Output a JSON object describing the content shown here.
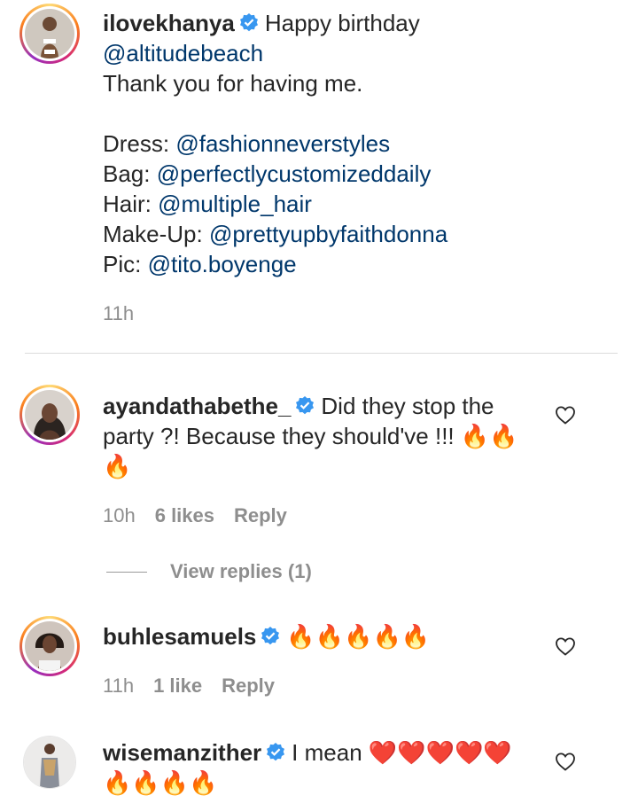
{
  "post": {
    "username": "ilovekhanya",
    "caption_first": "Happy birthday",
    "caption_mention": "@altitudebeach",
    "caption_line2": "Thank you for having me.",
    "credits": [
      {
        "label": "Dress:",
        "mention": "@fashionneverstyles"
      },
      {
        "label": "Bag:",
        "mention": "@perfectlycustomizeddaily"
      },
      {
        "label": "Hair:",
        "mention": "@multiple_hair"
      },
      {
        "label": "Make-Up:",
        "mention": "@prettyupbyfaithdonna"
      },
      {
        "label": "Pic:",
        "mention": "@tito.boyenge"
      }
    ],
    "time": "11h"
  },
  "comments": [
    {
      "username": "ayandathabethe_",
      "text": "Did they stop the party ?! Because they should've !!! 🔥🔥",
      "text_line2": "🔥",
      "time": "10h",
      "likes": "6 likes",
      "reply": "Reply",
      "view_replies": "View replies (1)"
    },
    {
      "username": "buhlesamuels",
      "text": "🔥🔥🔥🔥🔥",
      "time": "11h",
      "likes": "1 like",
      "reply": "Reply"
    },
    {
      "username": "wisemanzither",
      "text": "I mean ❤️❤️❤️❤️❤️",
      "text_line2": "🔥🔥🔥🔥"
    }
  ],
  "colors": {
    "mention": "#00376b",
    "verified": "#3897f0",
    "muted": "#8e8e8e"
  },
  "icons": [
    "verified-badge-icon",
    "heart-outline-icon"
  ]
}
